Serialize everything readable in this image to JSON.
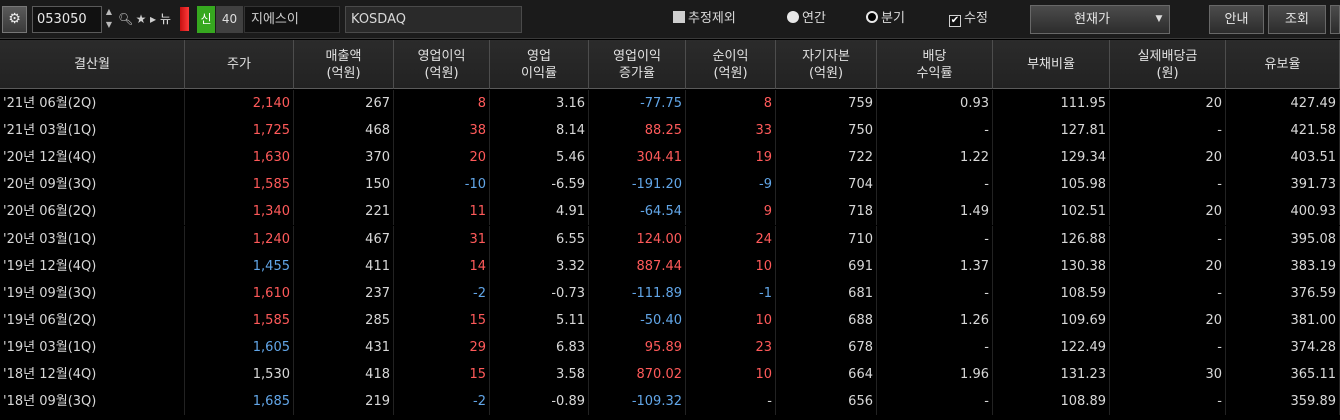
{
  "toolbar": {
    "gear_icon": "gear-icon",
    "stock_code": "053050",
    "spin_up": "▲",
    "spin_down": "▼",
    "search_icon": "🔍",
    "star_icon": "★",
    "arrow_icon": "▸",
    "new_label": "뉴",
    "credit_label": "신",
    "margin_rate": "40",
    "stock_name": "지에스이",
    "market": "KOSDAQ",
    "opt_exclude_estimate": "추정제외",
    "opt_annual": "연간",
    "opt_quarter": "분기",
    "opt_adjusted": "수정",
    "price_select": "현재가",
    "guide_button": "안내",
    "query_button": "조회"
  },
  "table": {
    "headers": [
      "결산월",
      "주가",
      "매출액\n(억원)",
      "영업이익\n(억원)",
      "영업\n이익률",
      "영업이익\n증가율",
      "순이익\n(억원)",
      "자기자본\n(억원)",
      "배당\n수익률",
      "부채비율",
      "실제배당금\n(원)",
      "유보율"
    ],
    "rows": [
      [
        "'21년 06월(2Q)",
        "2,140",
        "267",
        "8",
        "3.16",
        "-77.75",
        "8",
        "759",
        "0.93",
        "111.95",
        "20",
        "427.49"
      ],
      [
        "'21년 03월(1Q)",
        "1,725",
        "468",
        "38",
        "8.14",
        "88.25",
        "33",
        "750",
        "-",
        "127.81",
        "-",
        "421.58"
      ],
      [
        "'20년 12월(4Q)",
        "1,630",
        "370",
        "20",
        "5.46",
        "304.41",
        "19",
        "722",
        "1.22",
        "129.34",
        "20",
        "403.51"
      ],
      [
        "'20년 09월(3Q)",
        "1,585",
        "150",
        "-10",
        "-6.59",
        "-191.20",
        "-9",
        "704",
        "-",
        "105.98",
        "-",
        "391.73"
      ],
      [
        "'20년 06월(2Q)",
        "1,340",
        "221",
        "11",
        "4.91",
        "-64.54",
        "9",
        "718",
        "1.49",
        "102.51",
        "20",
        "400.93"
      ],
      [
        "'20년 03월(1Q)",
        "1,240",
        "467",
        "31",
        "6.55",
        "124.00",
        "24",
        "710",
        "-",
        "126.88",
        "-",
        "395.08"
      ],
      [
        "'19년 12월(4Q)",
        "1,455",
        "411",
        "14",
        "3.32",
        "887.44",
        "10",
        "691",
        "1.37",
        "130.38",
        "20",
        "383.19"
      ],
      [
        "'19년 09월(3Q)",
        "1,610",
        "237",
        "-2",
        "-0.73",
        "-111.89",
        "-1",
        "681",
        "-",
        "108.59",
        "-",
        "376.59"
      ],
      [
        "'19년 06월(2Q)",
        "1,585",
        "285",
        "15",
        "5.11",
        "-50.40",
        "10",
        "688",
        "1.26",
        "109.69",
        "20",
        "381.00"
      ],
      [
        "'19년 03월(1Q)",
        "1,605",
        "431",
        "29",
        "6.83",
        "95.89",
        "23",
        "678",
        "-",
        "122.49",
        "-",
        "374.28"
      ],
      [
        "'18년 12월(4Q)",
        "1,530",
        "418",
        "15",
        "3.58",
        "870.02",
        "10",
        "664",
        "1.96",
        "131.23",
        "30",
        "365.11"
      ],
      [
        "'18년 09월(3Q)",
        "1,685",
        "219",
        "-2",
        "-0.89",
        "-109.32",
        "-",
        "656",
        "-",
        "108.89",
        "-",
        "359.89"
      ]
    ],
    "row_colors": [
      [
        "w",
        "red",
        "w",
        "red",
        "w",
        "blue",
        "red",
        "w",
        "w",
        "w",
        "w",
        "w"
      ],
      [
        "w",
        "red",
        "w",
        "red",
        "w",
        "red",
        "red",
        "w",
        "w",
        "w",
        "w",
        "w"
      ],
      [
        "w",
        "red",
        "w",
        "red",
        "w",
        "red",
        "red",
        "w",
        "w",
        "w",
        "w",
        "w"
      ],
      [
        "w",
        "red",
        "w",
        "blue",
        "w",
        "blue",
        "blue",
        "w",
        "w",
        "w",
        "w",
        "w"
      ],
      [
        "w",
        "red",
        "w",
        "red",
        "w",
        "blue",
        "red",
        "w",
        "w",
        "w",
        "w",
        "w"
      ],
      [
        "w",
        "red",
        "w",
        "red",
        "w",
        "red",
        "red",
        "w",
        "w",
        "w",
        "w",
        "w"
      ],
      [
        "w",
        "blue",
        "w",
        "red",
        "w",
        "red",
        "red",
        "w",
        "w",
        "w",
        "w",
        "w"
      ],
      [
        "w",
        "red",
        "w",
        "blue",
        "w",
        "blue",
        "blue",
        "w",
        "w",
        "w",
        "w",
        "w"
      ],
      [
        "w",
        "red",
        "w",
        "red",
        "w",
        "blue",
        "red",
        "w",
        "w",
        "w",
        "w",
        "w"
      ],
      [
        "w",
        "blue",
        "w",
        "red",
        "w",
        "red",
        "red",
        "w",
        "w",
        "w",
        "w",
        "w"
      ],
      [
        "w",
        "w",
        "w",
        "red",
        "w",
        "red",
        "red",
        "w",
        "w",
        "w",
        "w",
        "w"
      ],
      [
        "w",
        "blue",
        "w",
        "blue",
        "w",
        "blue",
        "w",
        "w",
        "w",
        "w",
        "w",
        "w"
      ]
    ]
  },
  "colors": {
    "up": "#ff5a5a",
    "down": "#62a6e8",
    "accent_credit": "#36a81f"
  }
}
